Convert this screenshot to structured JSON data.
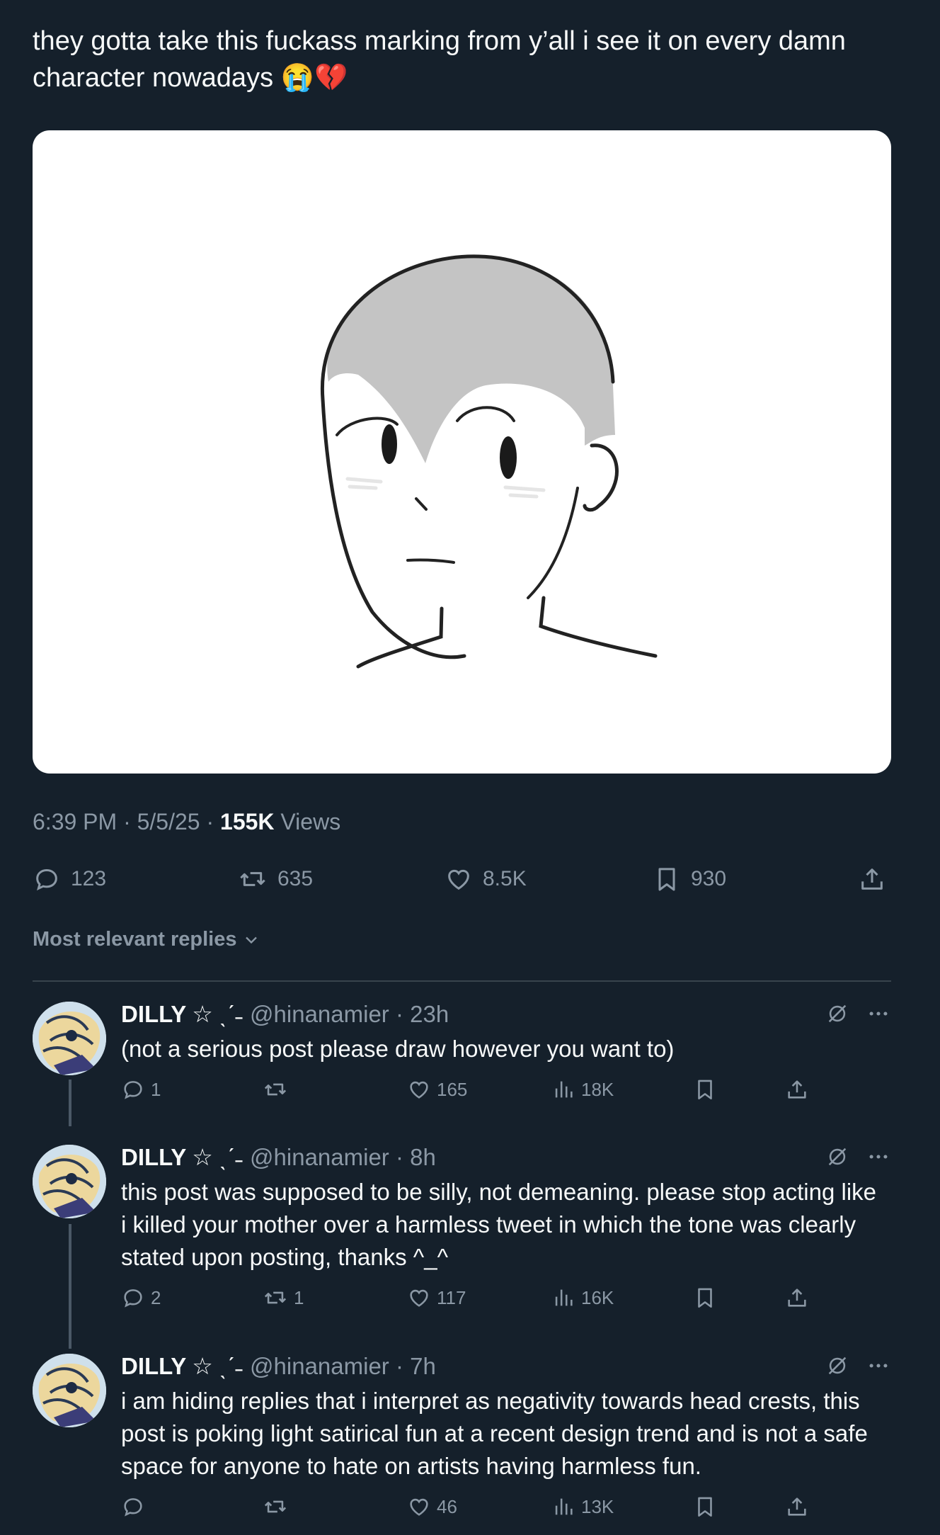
{
  "post": {
    "text": "they gotta take this fuckass marking from y’all i see it on every damn character nowadays 😭💔",
    "time": "6:39 PM · 5/5/25 · ",
    "views_count": "155K",
    "views_label": " Views"
  },
  "actions": {
    "replies": "123",
    "reposts": "635",
    "likes": "8.5K",
    "bookmarks": "930"
  },
  "sort": {
    "label": "Most relevant replies"
  },
  "replies": [
    {
      "name": "DILLY",
      "deco": "☆ ˎˊ˗",
      "handle": "@hinanamier · 23h",
      "text": "(not a serious post please draw however you want to)",
      "replies": "1",
      "reposts": "",
      "likes": "165",
      "views": "18K"
    },
    {
      "name": "DILLY",
      "deco": "☆ ˎˊ˗",
      "handle": "@hinanamier · 8h",
      "text": "this post was supposed to be silly, not demeaning. please stop acting like i killed your mother over a harmless tweet in which the tone was clearly stated upon posting, thanks ^_^",
      "replies": "2",
      "reposts": "1",
      "likes": "117",
      "views": "16K"
    },
    {
      "name": "DILLY",
      "deco": "☆ ˎˊ˗",
      "handle": "@hinanamier · 7h",
      "text": "i am hiding replies that i interpret as negativity towards head crests, this post is poking light satirical fun at a recent design trend and is not a safe space for anyone to hate on artists having harmless fun.",
      "replies": "",
      "reposts": "",
      "likes": "46",
      "views": "13K"
    }
  ],
  "colors": {
    "background": "#15202b",
    "text": "#f7f9f9",
    "muted": "#8b98a5",
    "divider": "#38444d"
  },
  "icons": [
    "reply-icon",
    "repost-icon",
    "like-icon",
    "bookmark-icon",
    "share-icon",
    "views-icon",
    "chevron-down-icon",
    "grok-icon",
    "more-icon"
  ]
}
